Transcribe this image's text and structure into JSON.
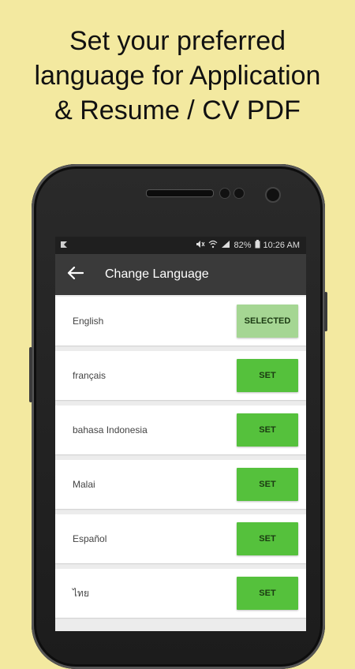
{
  "headline": {
    "line1": "Set your preferred",
    "line2": "language for Application",
    "line3": "& Resume / CV PDF"
  },
  "status_bar": {
    "battery": "82%",
    "time": "10:26 AM",
    "icons": [
      "notification-icon",
      "mute-icon",
      "wifi-icon",
      "signal-icon",
      "battery-icon"
    ]
  },
  "app_bar": {
    "title": "Change Language",
    "back_icon": "arrow-left-icon"
  },
  "languages": [
    {
      "name": "English",
      "action": "SELECTED"
    },
    {
      "name": "français",
      "action": "SET"
    },
    {
      "name": "bahasa Indonesia",
      "action": "SET"
    },
    {
      "name": "Malai",
      "action": "SET"
    },
    {
      "name": "Español",
      "action": "SET"
    },
    {
      "name": "ไทย",
      "action": "SET"
    }
  ],
  "colors": {
    "background": "#f3e9a0",
    "app_bar": "#3a3a3a",
    "set_button": "#55c13c",
    "selected_button": "#a5d693"
  }
}
